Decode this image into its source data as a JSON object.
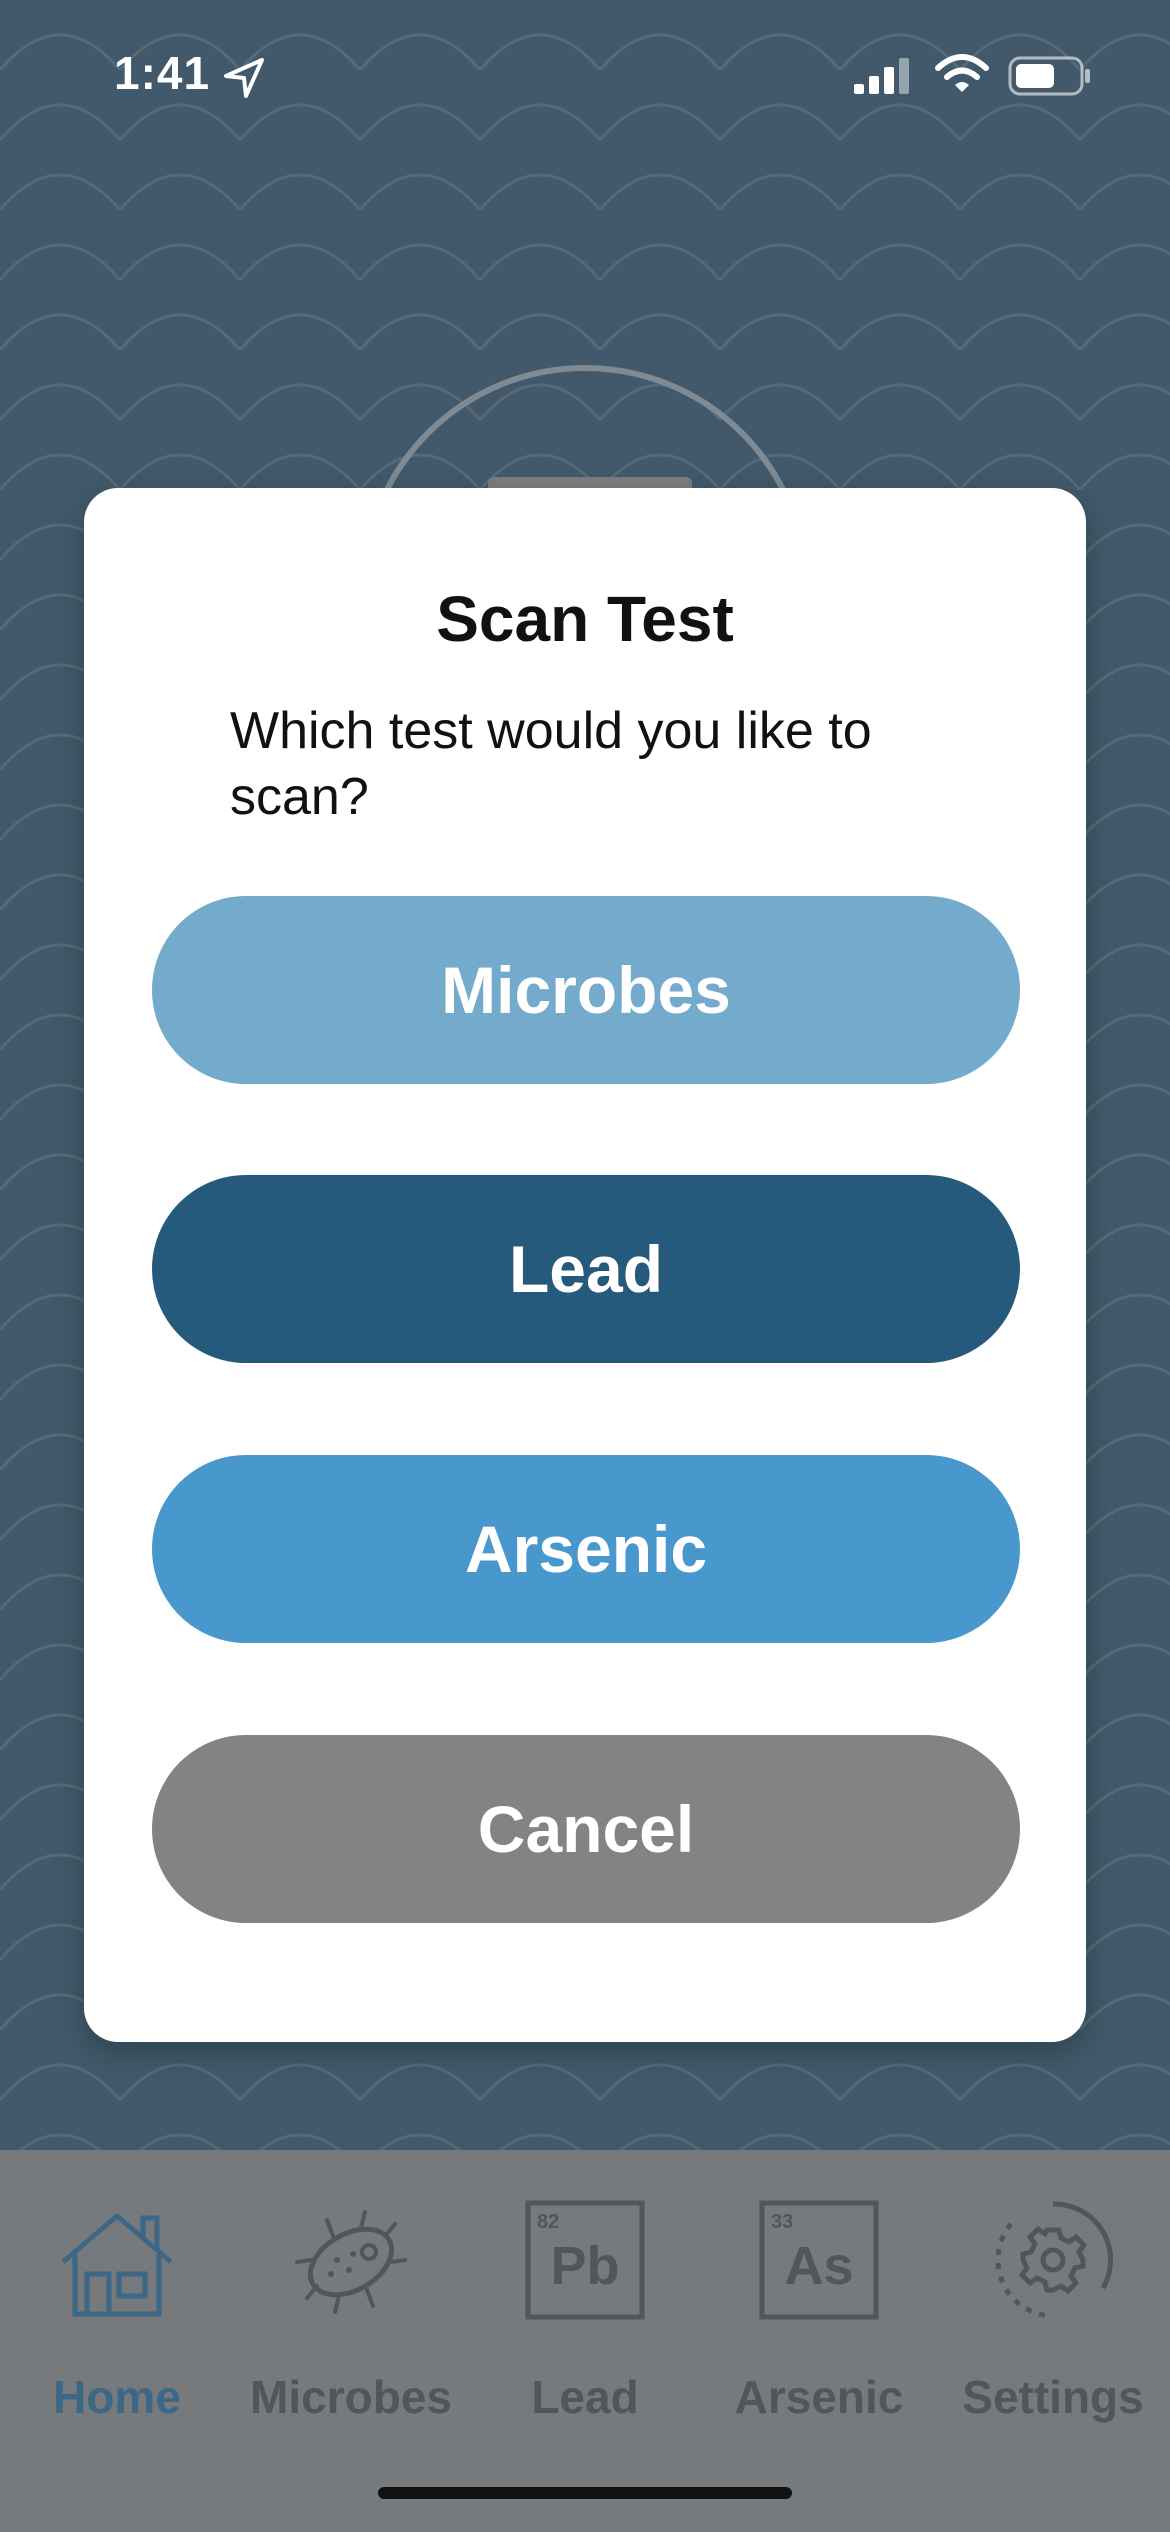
{
  "status_bar": {
    "time": "1:41"
  },
  "modal": {
    "title": "Scan Test",
    "message": "Which test would you like to scan?",
    "buttons": {
      "microbes": "Microbes",
      "lead": "Lead",
      "arsenic": "Arsenic",
      "cancel": "Cancel"
    }
  },
  "tab_bar": {
    "tabs": [
      {
        "label": "Home",
        "icon": "house-icon",
        "active": true
      },
      {
        "label": "Microbes",
        "icon": "microbe-icon",
        "active": false
      },
      {
        "label": "Lead",
        "icon": "lead-element-icon",
        "active": false
      },
      {
        "label": "Arsenic",
        "icon": "arsenic-element-icon",
        "active": false
      },
      {
        "label": "Settings",
        "icon": "gear-icon",
        "active": false
      }
    ],
    "lead_icon": {
      "number": "82",
      "symbol": "Pb"
    },
    "arsenic_icon": {
      "number": "33",
      "symbol": "As"
    }
  },
  "colors": {
    "background": "#41596a",
    "microbes_button": "#74aacb",
    "lead_button": "#265a7d",
    "arsenic_button": "#4897cd",
    "cancel_button": "#838383",
    "tab_active": "#3c6787",
    "tab_inactive": "#50565a"
  }
}
